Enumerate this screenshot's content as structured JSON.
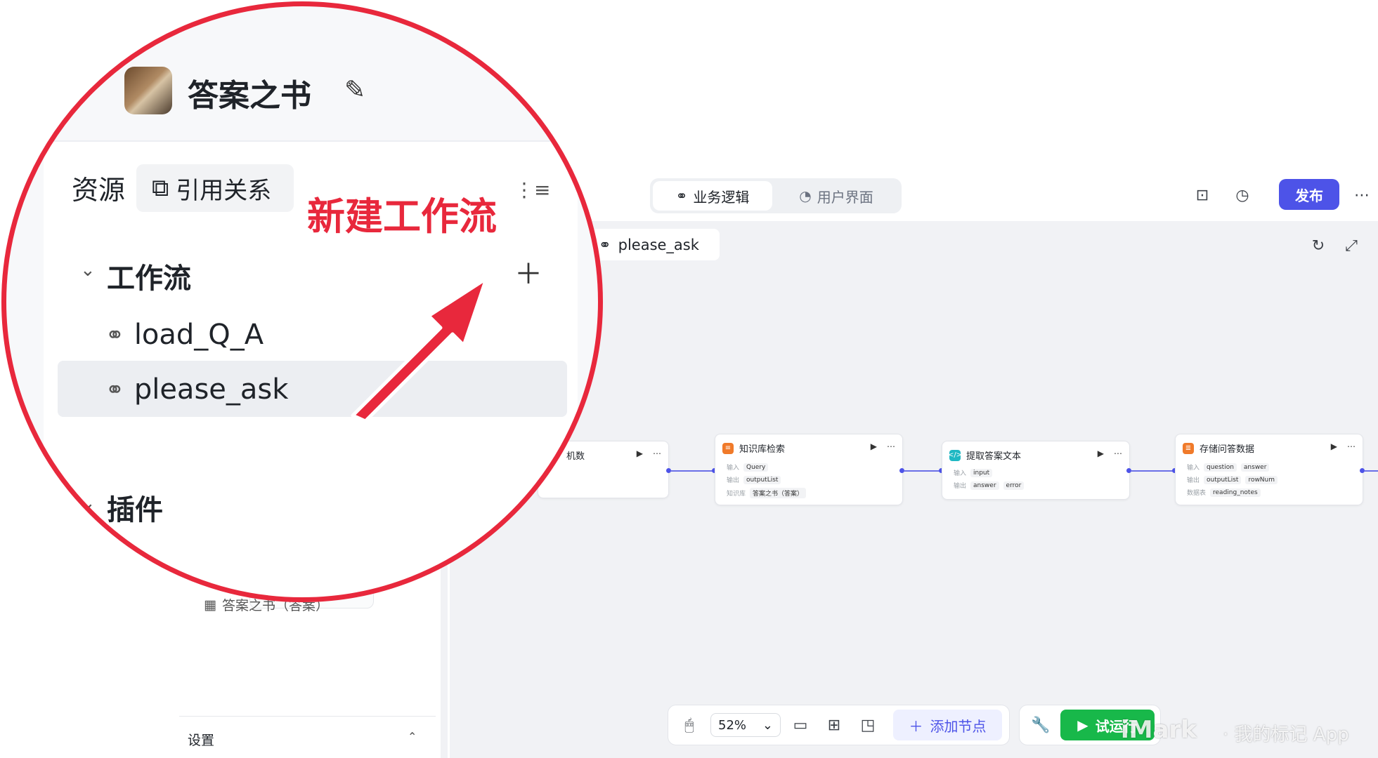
{
  "app": {
    "name": "答案之书"
  },
  "header": {
    "tabs": [
      {
        "label": "业务逻辑",
        "active": true
      },
      {
        "label": "用户界面",
        "active": false
      }
    ],
    "publish_label": "发布",
    "icons": [
      "archive-icon",
      "history-icon",
      "more-icon"
    ]
  },
  "sidebar": {
    "tab_resources": "资源",
    "tab_references": "引用关系",
    "annotation": "新建工作流",
    "workflow_section": "工作流",
    "workflows": [
      {
        "label": "load_Q_A"
      },
      {
        "label": "please_ask",
        "selected": true
      }
    ],
    "plugin_section": "插件",
    "table_item": "答案之书（答案）",
    "settings_label": "设置"
  },
  "canvas": {
    "open_tab": "please_ask",
    "nodes": [
      {
        "title": "机数",
        "rows": []
      },
      {
        "title": "知识库检索",
        "rows": [
          {
            "label": "输入",
            "tags": [
              "Query"
            ]
          },
          {
            "label": "输出",
            "tags": [
              "outputList"
            ]
          },
          {
            "label": "知识库",
            "tags": [
              "答案之书（答案）"
            ]
          }
        ]
      },
      {
        "title": "提取答案文本",
        "rows": [
          {
            "label": "输入",
            "tags": [
              "input"
            ]
          },
          {
            "label": "输出",
            "tags": [
              "answer",
              "error"
            ]
          }
        ]
      },
      {
        "title": "存储问答数据",
        "rows": [
          {
            "label": "输入",
            "tags": [
              "question",
              "answer"
            ]
          },
          {
            "label": "输出",
            "tags": [
              "outputList",
              "rowNum"
            ]
          },
          {
            "label": "数据表",
            "tags": [
              "reading_notes"
            ]
          }
        ]
      }
    ]
  },
  "toolbar": {
    "zoom": "52%",
    "add_node": "添加节点",
    "test_run": "试运行"
  },
  "watermark": {
    "brand": "iMark",
    "text": "· 我的标记 App"
  },
  "colors": {
    "accent": "#4d53e8",
    "run": "#18b84a",
    "annotation": "#e8283c"
  }
}
